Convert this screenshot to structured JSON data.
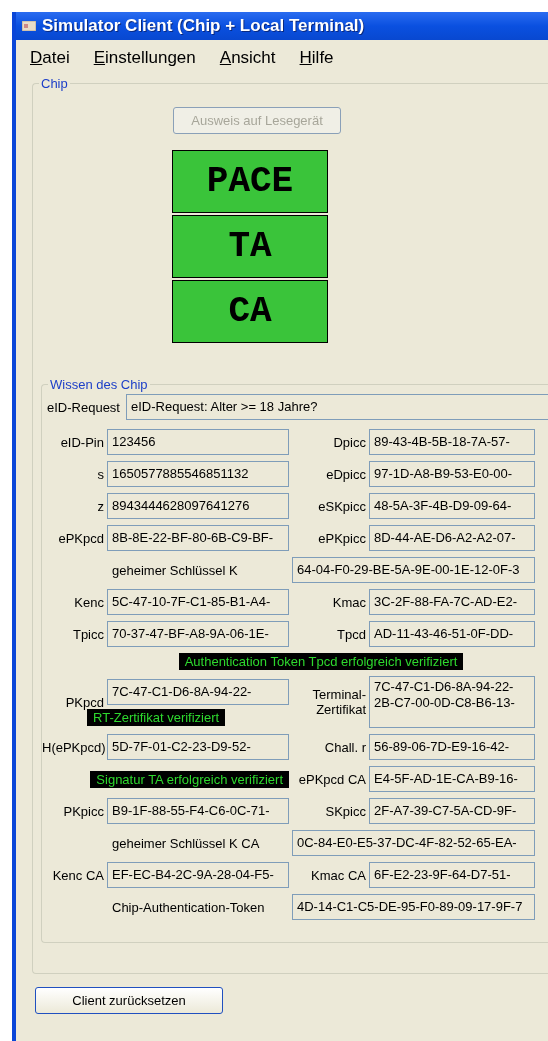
{
  "window": {
    "title": "Simulator Client (Chip + Local Terminal)"
  },
  "menu": [
    "Datei",
    "Einstellungen",
    "Ansicht",
    "Hilfe"
  ],
  "chip": {
    "title": "Chip",
    "reader_button": {
      "label": "Ausweis auf Lesegerät",
      "disabled": true
    },
    "steps": [
      {
        "label": "PACE",
        "done": true
      },
      {
        "label": "TA",
        "done": true
      },
      {
        "label": "CA",
        "done": true
      }
    ]
  },
  "knowledge": {
    "title": "Wissen des Chip",
    "rows": [
      {
        "kind": "wide",
        "label": "eID-Request",
        "value": "eID-Request: Alter >= 18 Jahre?"
      },
      {
        "kind": "pair",
        "left": {
          "kind": "field",
          "label": "eID-Pin",
          "value": "123456"
        },
        "right": {
          "kind": "field",
          "label": "Dpicc",
          "value": "89-43-4B-5B-18-7A-57-"
        }
      },
      {
        "kind": "pair",
        "left": {
          "kind": "field",
          "label": "s",
          "value": "1650577885546851132"
        },
        "right": {
          "kind": "field",
          "label": "eDpicc",
          "value": "97-1D-A8-B9-53-E0-00-"
        }
      },
      {
        "kind": "pair",
        "left": {
          "kind": "field",
          "label": "z",
          "value": "8943444628097641276"
        },
        "right": {
          "kind": "field",
          "label": "eSKpicc",
          "value": "48-5A-3F-4B-D9-09-64-"
        }
      },
      {
        "kind": "pair",
        "left": {
          "kind": "field",
          "label": "ePKpcd",
          "value": "8B-8E-22-BF-80-6B-C9-BF-"
        },
        "right": {
          "kind": "field",
          "label": "ePKpicc",
          "value": "8D-44-AE-D6-A2-A2-07-"
        }
      },
      {
        "kind": "key",
        "label": "geheimer Schlüssel K",
        "value": "64-04-F0-29-BE-5A-9E-00-1E-12-0F-3"
      },
      {
        "kind": "pair",
        "left": {
          "kind": "field",
          "label": "Kenc",
          "value": "5C-47-10-7F-C1-85-B1-A4-"
        },
        "right": {
          "kind": "field",
          "label": "Kmac",
          "value": "3C-2F-88-FA-7C-AD-E2-"
        }
      },
      {
        "kind": "pair",
        "left": {
          "kind": "field",
          "label": "Tpicc",
          "value": "70-37-47-BF-A8-9A-06-1E-"
        },
        "right": {
          "kind": "field",
          "label": "Tpcd",
          "value": "AD-11-43-46-51-0F-DD-"
        }
      },
      {
        "kind": "status",
        "text": "Authentication Token Tpcd erfolgreich verifiziert"
      },
      {
        "kind": "pair",
        "left": {
          "kind": "field",
          "label": "PKpcd",
          "value": "7C-47-C1-D6-8A-94-22-",
          "note": "RT-Zertifikat verifiziert"
        },
        "right": {
          "kind": "multiline",
          "label": "Terminal-Zertifikat",
          "lines": [
            "7C-47-C1-D6-8A-94-22-",
            "2B-C7-00-0D-C8-B6-13-"
          ]
        }
      },
      {
        "kind": "pair",
        "left": {
          "kind": "field",
          "label": "H(ePKpcd)",
          "value": "5D-7F-01-C2-23-D9-52-"
        },
        "right": {
          "kind": "field",
          "label": "Chall. r",
          "value": "56-89-06-7D-E9-16-42-"
        }
      },
      {
        "kind": "pair",
        "left": {
          "kind": "status",
          "text": "Signatur TA erfolgreich verifiziert"
        },
        "right": {
          "kind": "field",
          "label": "ePKpcd CA",
          "value": "E4-5F-AD-1E-CA-B9-16-"
        }
      },
      {
        "kind": "pair",
        "left": {
          "kind": "field",
          "label": "PKpicc",
          "value": "B9-1F-88-55-F4-C6-0C-71-"
        },
        "right": {
          "kind": "field",
          "label": "SKpicc",
          "value": "2F-A7-39-C7-5A-CD-9F-"
        }
      },
      {
        "kind": "key",
        "label": "geheimer Schlüssel K CA",
        "value": "0C-84-E0-E5-37-DC-4F-82-52-65-EA-"
      },
      {
        "kind": "pair",
        "left": {
          "kind": "field",
          "label": "Kenc CA",
          "value": "EF-EC-B4-2C-9A-28-04-F5-"
        },
        "right": {
          "kind": "field",
          "label": "Kmac CA",
          "value": "6F-E2-23-9F-64-D7-51-"
        }
      },
      {
        "kind": "key",
        "label": "Chip-Authentication-Token",
        "value": "4D-14-C1-C5-DE-95-F0-89-09-17-9F-7"
      }
    ]
  },
  "reset_button": {
    "label": "Client zurücksetzen"
  }
}
